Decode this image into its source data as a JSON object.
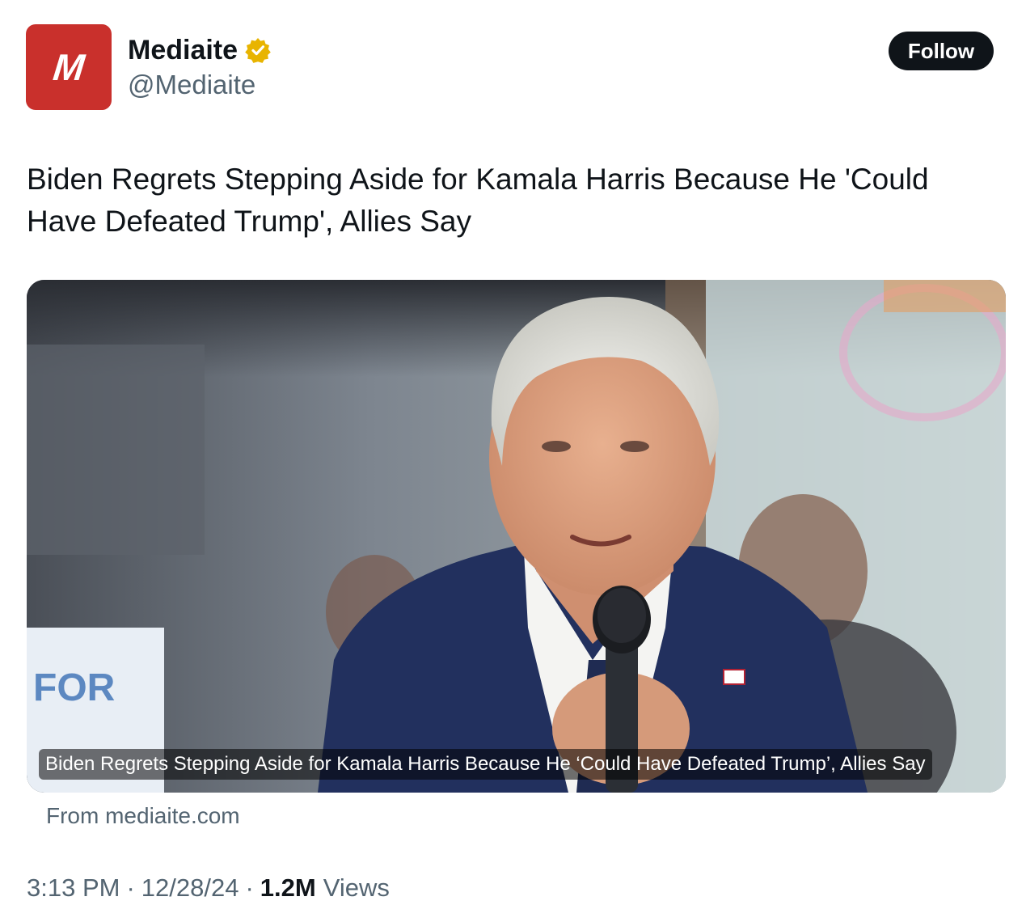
{
  "account": {
    "avatar_letter": "M",
    "avatar_color": "#c9302c",
    "display_name": "Mediaite",
    "handle": "@Mediaite",
    "verified_icon": "verified-badge-gold",
    "verified_color": "#e8b400"
  },
  "follow_button": {
    "label": "Follow"
  },
  "tweet": {
    "text": "Biden Regrets Stepping Aside for Kamala Harris Because He 'Could Have Defeated Trump', Allies Say"
  },
  "card": {
    "caption": "Biden Regrets Stepping Aside for Kamala Harris Because He ‘Could Have Defeated Trump’, Allies Say",
    "source": "From mediaite.com"
  },
  "meta": {
    "time": "3:13 PM",
    "date": "12/28/24",
    "views_count": "1.2M",
    "views_label": "Views",
    "separator": "·"
  }
}
